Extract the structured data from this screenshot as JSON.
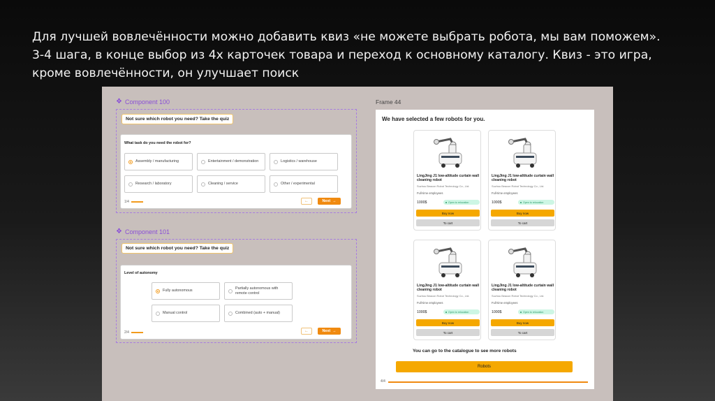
{
  "headline": {
    "line1": "Для лучшей вовлечённости можно добавить квиз «не можете выбрать робота, мы вам поможем».",
    "line2": "3-4 шага, в конце выбор из 4х карточек товара и переход к основному каталогу.  Квиз  - это игра,",
    "line3": "кроме вовлечённости, он улучшает поиск"
  },
  "component100": {
    "label": "Component 100",
    "quiz_tag": "Not sure which robot you need? Take the quiz",
    "question": "What task do you need the robot for?",
    "options": [
      {
        "label": "Assembly / manufacturing",
        "selected": true
      },
      {
        "label": "Entertainment / demonstration",
        "selected": false
      },
      {
        "label": "Logistics / warehouse",
        "selected": false
      },
      {
        "label": "Research / laboratory",
        "selected": false
      },
      {
        "label": "Cleaning / service",
        "selected": false
      },
      {
        "label": "Other / experimental",
        "selected": false
      }
    ],
    "step": "1/4",
    "next": "Next"
  },
  "component101": {
    "label": "Component 101",
    "quiz_tag": "Not sure which robot you need? Take the quiz",
    "question": "Level of autonomy",
    "options": [
      {
        "label": "Fully autonomous",
        "selected": true
      },
      {
        "label": "Partially autonomous with remote control",
        "selected": false
      },
      {
        "label": "Manual control",
        "selected": false
      },
      {
        "label": "Combined (auto + manual)",
        "selected": false
      }
    ],
    "step": "2/4",
    "next": "Next"
  },
  "frame44": {
    "label": "Frame 44",
    "title": "We have selected a few robots for you.",
    "products": [
      {
        "name": "LingJing J1 low-altitude curtain wall cleaning robot",
        "company": "Suzhou Beacon Robot Technology Co., Ltd.",
        "employment": "Full-time employees",
        "price": "1000$",
        "badge": "Open to relocation",
        "buy": "Buy now",
        "cart": "To cart"
      },
      {
        "name": "LingJing J1 low-altitude curtain wall cleaning robot",
        "company": "Suzhou Beacon Robot Technology Co., Ltd.",
        "employment": "Full-time employees",
        "price": "1000$",
        "badge": "Open to relocation",
        "buy": "Buy now",
        "cart": "To cart"
      },
      {
        "name": "LingJing J1 low-altitude curtain wall cleaning robot",
        "company": "Suzhou Beacon Robot Technology Co., Ltd.",
        "employment": "Full-time employees",
        "price": "1000$",
        "badge": "Open to relocation",
        "buy": "Buy now",
        "cart": "To cart"
      },
      {
        "name": "LingJing J1 low-altitude curtain wall cleaning robot",
        "company": "Suzhou Beacon Robot Technology Co., Ltd.",
        "employment": "Full-time employees",
        "price": "1000$",
        "badge": "Open to relocation",
        "buy": "Buy now",
        "cart": "To cart"
      }
    ],
    "catalogue_text": "You can go to the catalogue to see more robots",
    "robots_button": "Robots",
    "step": "4/4"
  },
  "colors": {
    "accent": "#f08a10",
    "buy": "#f5a800",
    "purple": "#8a4fd6",
    "badge_bg": "#cdf6e4"
  },
  "icons": {
    "component": "diamond-icon",
    "back": "arrow-left-icon",
    "next": "arrow-right-icon",
    "product": "robot-icon"
  }
}
